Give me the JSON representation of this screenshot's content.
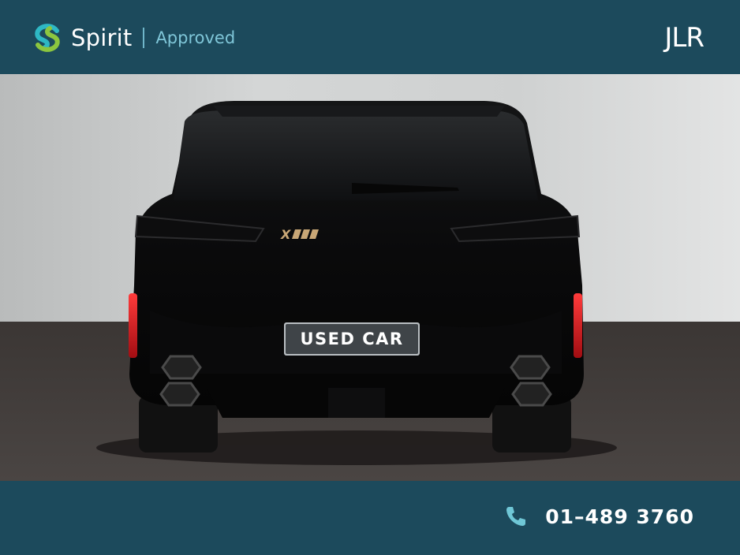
{
  "header": {
    "brand_name": "Spirit",
    "brand_sub": "Approved",
    "dealer_logo": "JLR"
  },
  "photo": {
    "badge_text": "X M",
    "plate_text": "USED CAR"
  },
  "footer": {
    "phone_number": "01–489 3760",
    "phone_icon": "phone-icon"
  },
  "colors": {
    "band": "#1c4a5c",
    "brand_green": "#8cc63f",
    "brand_teal": "#2eb8c4",
    "accent_text": "#7fc6d8"
  }
}
